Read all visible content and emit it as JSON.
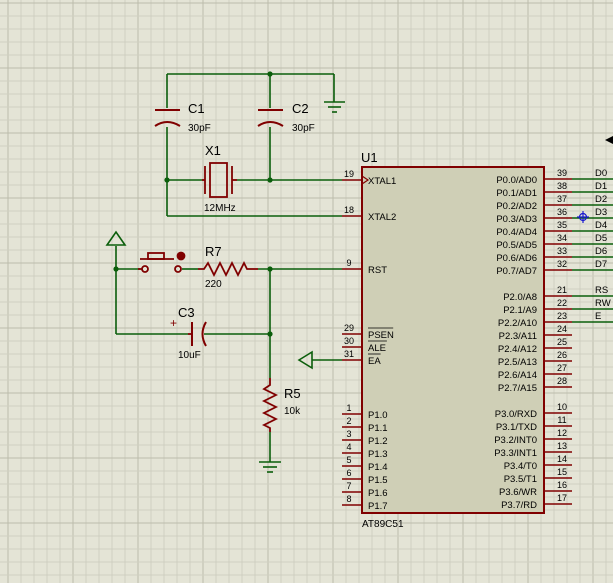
{
  "colors": {
    "background": "#e4e4d6",
    "grid_minor": "#cdcdbf",
    "grid_major": "#b8b8a8",
    "wire": "#0b5e0b",
    "component": "#800000",
    "chip_fill": "#cfcfb6",
    "text": "#000000",
    "selection": "#1a1ad0"
  },
  "chip": {
    "ref": "U1",
    "part": "AT89C51",
    "left_pins": [
      {
        "num": "19",
        "label": "XTAL1"
      },
      {
        "num": "18",
        "label": "XTAL2"
      },
      {
        "num": "9",
        "label": "RST"
      },
      {
        "num": "29",
        "label": "PSEN"
      },
      {
        "num": "30",
        "label": "ALE"
      },
      {
        "num": "31",
        "label": "EA"
      },
      {
        "num": "1",
        "label": "P1.0"
      },
      {
        "num": "2",
        "label": "P1.1"
      },
      {
        "num": "3",
        "label": "P1.2"
      },
      {
        "num": "4",
        "label": "P1.3"
      },
      {
        "num": "5",
        "label": "P1.4"
      },
      {
        "num": "6",
        "label": "P1.5"
      },
      {
        "num": "7",
        "label": "P1.6"
      },
      {
        "num": "8",
        "label": "P1.7"
      }
    ],
    "right_pins": [
      {
        "num": "39",
        "label": "P0.0/AD0"
      },
      {
        "num": "38",
        "label": "P0.1/AD1"
      },
      {
        "num": "37",
        "label": "P0.2/AD2"
      },
      {
        "num": "36",
        "label": "P0.3/AD3"
      },
      {
        "num": "35",
        "label": "P0.4/AD4"
      },
      {
        "num": "34",
        "label": "P0.5/AD5"
      },
      {
        "num": "33",
        "label": "P0.6/AD6"
      },
      {
        "num": "32",
        "label": "P0.7/AD7"
      },
      {
        "num": "21",
        "label": "P2.0/A8"
      },
      {
        "num": "22",
        "label": "P2.1/A9"
      },
      {
        "num": "23",
        "label": "P2.2/A10"
      },
      {
        "num": "24",
        "label": "P2.3/A11"
      },
      {
        "num": "25",
        "label": "P2.4/A12"
      },
      {
        "num": "26",
        "label": "P2.5/A13"
      },
      {
        "num": "27",
        "label": "P2.6/A14"
      },
      {
        "num": "28",
        "label": "P2.7/A15"
      },
      {
        "num": "10",
        "label": "P3.0/RXD"
      },
      {
        "num": "11",
        "label": "P3.1/TXD"
      },
      {
        "num": "12",
        "label": "P3.2/INT0"
      },
      {
        "num": "13",
        "label": "P3.3/INT1"
      },
      {
        "num": "14",
        "label": "P3.4/T0"
      },
      {
        "num": "15",
        "label": "P3.5/T1"
      },
      {
        "num": "16",
        "label": "P3.6/WR"
      },
      {
        "num": "17",
        "label": "P3.7/RD"
      }
    ]
  },
  "net_labels": [
    "D0",
    "D1",
    "D2",
    "D3",
    "D4",
    "D5",
    "D6",
    "D7",
    "RS",
    "RW",
    "E"
  ],
  "components": {
    "c1": {
      "ref": "C1",
      "value": "30pF"
    },
    "c2": {
      "ref": "C2",
      "value": "30pF"
    },
    "x1": {
      "ref": "X1",
      "value": "12MHz"
    },
    "r7": {
      "ref": "R7",
      "value": "220"
    },
    "c3": {
      "ref": "C3",
      "value": "10uF"
    },
    "r5": {
      "ref": "R5",
      "value": "10k"
    }
  }
}
